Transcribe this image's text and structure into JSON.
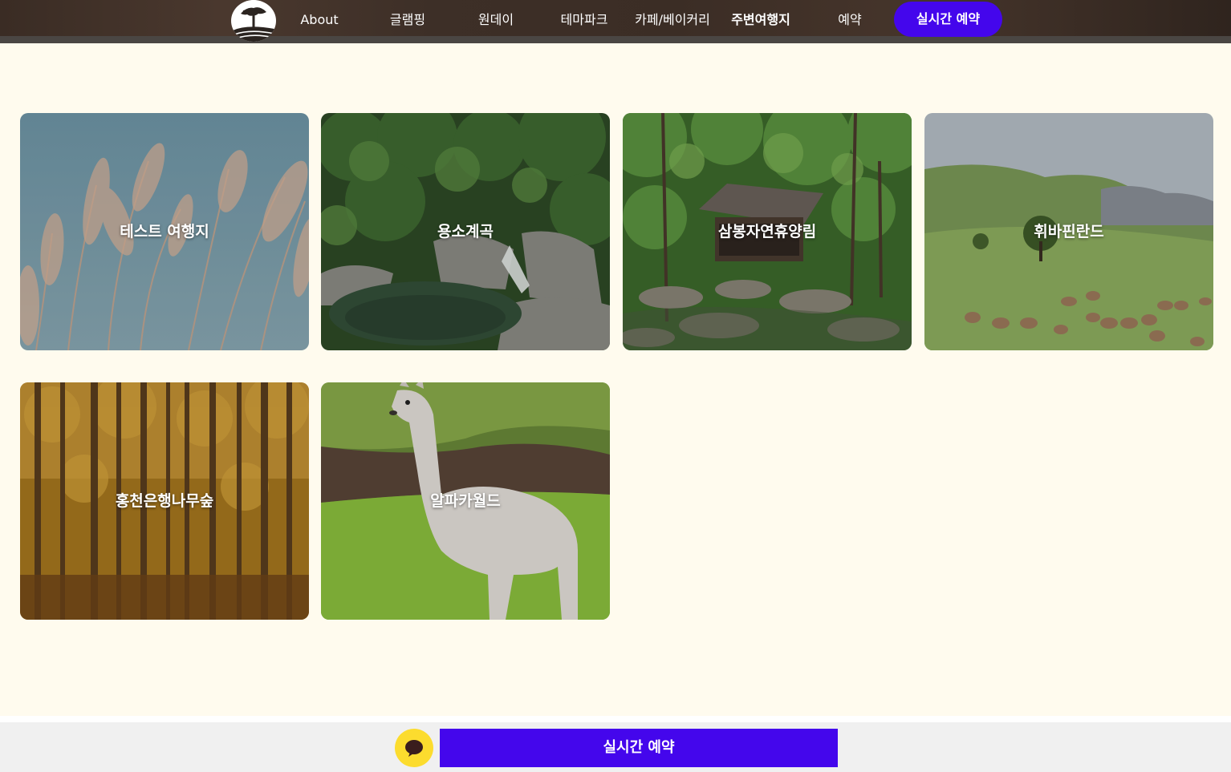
{
  "header": {
    "logo_icon": "tree-on-hill-logo-icon",
    "nav": [
      {
        "label": "About",
        "active": false
      },
      {
        "label": "글램핑",
        "active": false
      },
      {
        "label": "원데이",
        "active": false
      },
      {
        "label": "테마파크",
        "active": false
      },
      {
        "label": "카페/베이커리",
        "active": false
      },
      {
        "label": "주변여행지",
        "active": true
      },
      {
        "label": "예약",
        "active": false
      }
    ],
    "cta_label": "실시간 예약"
  },
  "destinations": [
    {
      "title": "테스트 여행지",
      "image": "pampas-grass-sky"
    },
    {
      "title": "용소계곡",
      "image": "valley-waterfall"
    },
    {
      "title": "삼봉자연휴양림",
      "image": "forest-pavilion"
    },
    {
      "title": "휘바핀란드",
      "image": "sheep-meadow"
    },
    {
      "title": "홍천은행나무숲",
      "image": "ginkgo-forest"
    },
    {
      "title": "알파카월드",
      "image": "alpaca-grass"
    }
  ],
  "footer": {
    "chat_icon": "kakao-chat-icon",
    "cta_label": "실시간 예약"
  },
  "colors": {
    "accent": "#4406ec",
    "background": "#fffbee",
    "kakao": "#fcdc2e"
  }
}
